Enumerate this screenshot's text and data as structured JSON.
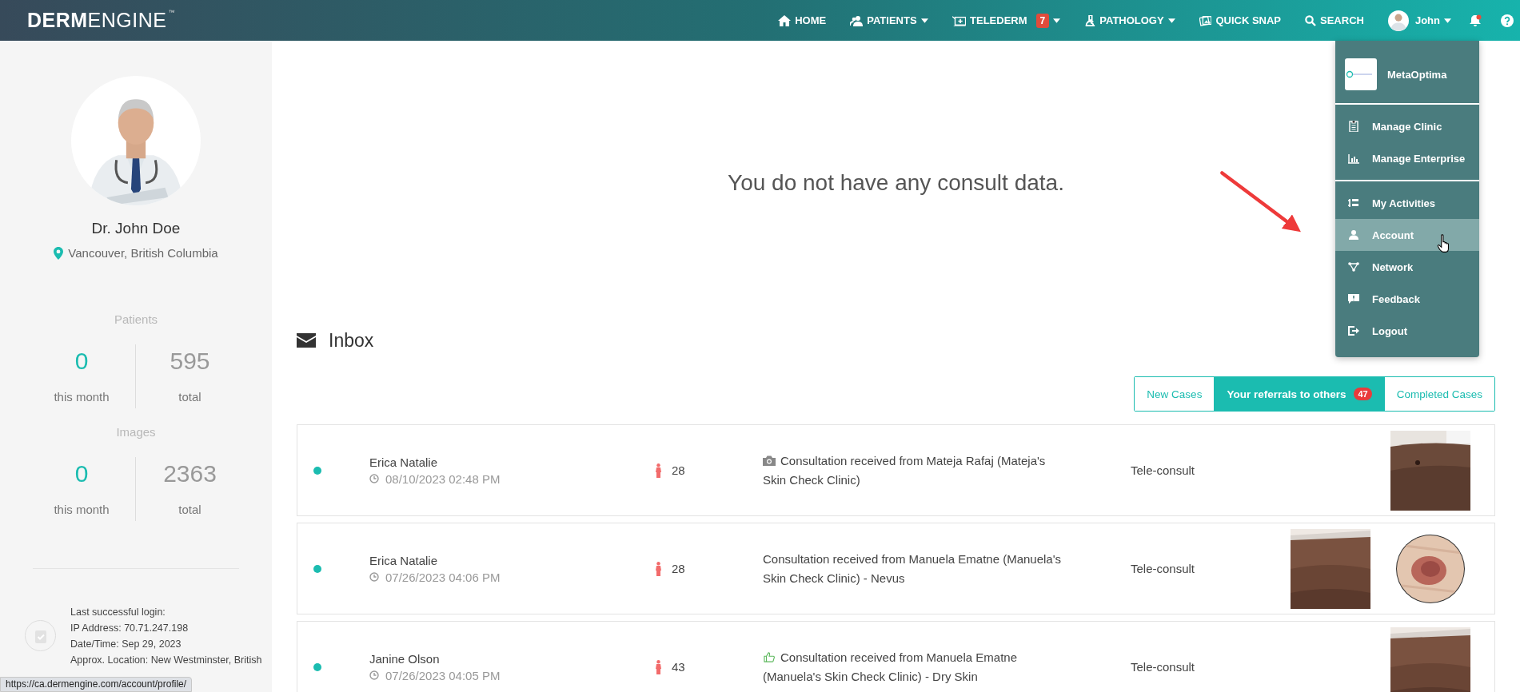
{
  "brand": {
    "bold": "DERM",
    "light": "ENGINE",
    "mark": "™"
  },
  "nav": [
    {
      "kind": "home",
      "label": "HOME",
      "caret": false
    },
    {
      "kind": "patients",
      "label": "PATIENTS",
      "caret": true
    },
    {
      "kind": "telederm",
      "label": "TELEDERM",
      "badge": "7",
      "caret": true
    },
    {
      "kind": "pathology",
      "label": "PATHOLOGY",
      "caret": true
    },
    {
      "kind": "snap",
      "label": "QUICK SNAP",
      "caret": false
    },
    {
      "kind": "search",
      "label": "SEARCH",
      "caret": false
    }
  ],
  "user": {
    "name": "John",
    "caret": true,
    "notification": true
  },
  "profile": {
    "name": "Dr. John Doe",
    "location": "Vancouver, British Columbia"
  },
  "stats": [
    {
      "title": "Patients",
      "month_value": "0",
      "month_label": "this month",
      "total_value": "595",
      "total_label": "total"
    },
    {
      "title": "Images",
      "month_value": "0",
      "month_label": "this month",
      "total_value": "2363",
      "total_label": "total"
    }
  ],
  "last_login": [
    "Last successful login:",
    "IP Address: 70.71.247.198",
    "Date/Time: Sep 29, 2023",
    "Approx. Location: New Westminster, British"
  ],
  "status_url": "https://ca.dermengine.com/account/profile/",
  "empty_message": "You do not have any consult data.",
  "inbox": {
    "title": "Inbox",
    "tabs": [
      {
        "label": "New Cases",
        "selected": false
      },
      {
        "label": "Your referrals to others",
        "badge": "47",
        "selected": true
      },
      {
        "label": "Completed Cases",
        "selected": false
      }
    ],
    "rows": [
      {
        "name": "Erica Natalie",
        "datetime": "08/10/2023 02:48 PM",
        "age": "28",
        "subject": "Consultation received from Mateja Rafaj (Mateja's Skin Check Clinic)",
        "type": "Tele-consult",
        "images": [
          {
            "kind": "picture",
            "round": false
          }
        ]
      },
      {
        "name": "Erica Natalie",
        "datetime": "07/26/2023 04:06 PM",
        "age": "28",
        "kind": "plain",
        "subject": "Consultation received from Manuela Ematne (Manuela's Skin Check Clinic) - Nevus",
        "type": "Tele-consult",
        "images": [
          {
            "kind": "picture",
            "round": false
          },
          {
            "kind": "picture",
            "round": true
          }
        ]
      },
      {
        "name": "Janine Olson",
        "datetime": "07/26/2023 04:05 PM",
        "age": "43",
        "kind": "approved",
        "subject": "Consultation received from Manuela Ematne (Manuela's Skin Check Clinic) - Dry Skin",
        "type": "Tele-consult",
        "images": [
          {
            "kind": "picture",
            "round": false
          }
        ]
      }
    ]
  },
  "account_menu": {
    "org": "MetaOptima",
    "groups": [
      [
        {
          "kind": "clinic",
          "label": "Manage Clinic",
          "highlighted": false
        },
        {
          "kind": "enterprise",
          "label": "Manage Enterprise",
          "highlighted": false
        }
      ],
      [
        {
          "kind": "activities",
          "label": "My Activities",
          "highlighted": false
        },
        {
          "kind": "account",
          "label": "Account",
          "highlighted": true
        },
        {
          "kind": "network",
          "label": "Network",
          "highlighted": false
        },
        {
          "kind": "feedback",
          "label": "Feedback",
          "highlighted": false
        },
        {
          "kind": "logout",
          "label": "Logout",
          "highlighted": false
        }
      ]
    ]
  }
}
